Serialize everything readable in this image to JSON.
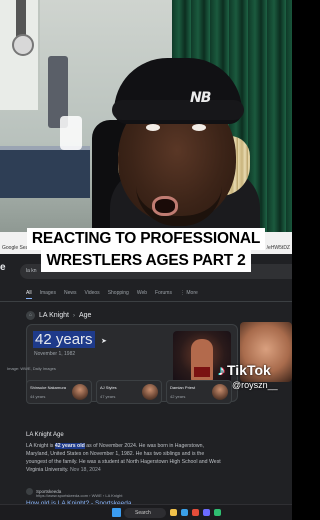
{
  "caption": {
    "line1": "REACTING TO PROFESSIONAL",
    "line2": "WRESTLERS AGES PART 2"
  },
  "cam": {
    "beanie_logo": "NB"
  },
  "desktop_strip": {
    "left_text": "Google Sea",
    "right_text": "/eHW5tDZ"
  },
  "browser": {
    "search_value": "la kn",
    "tabs": [
      "All",
      "Images",
      "News",
      "Videos",
      "Shopping",
      "Web",
      "Forums",
      "⋮ More"
    ],
    "knowledge": {
      "breadcrumb": "LA Knight",
      "subject": "Age",
      "answer": "42 years",
      "birth_date": "November 1, 1982",
      "image_credit": "Image: WWE, Daily Images"
    },
    "people": [
      {
        "name": "Shinsuke Nakamura",
        "age": "44 years"
      },
      {
        "name": "AJ Styles",
        "age": "47 years"
      },
      {
        "name": "Damian Priest",
        "age": "42 years"
      }
    ],
    "section_title": "LA Knight Age",
    "snippet": {
      "pre": "LA Knight is ",
      "highlight": "42 years old",
      "post": " as of November 2024. He was born in Hagerstown, Maryland, United States on November 1, 1982. He has two siblings and is the youngest of the family. He was a student at North Hagerstown High School and West Virginia University.",
      "date": "Nov 18, 2024"
    },
    "source": {
      "name": "Sportskeeda",
      "url": "https://www.sportskeeda.com › WWE › LA Knight"
    },
    "result_link": "How old is LA Knight? - Sportskeeda"
  },
  "taskbar": {
    "search_label": "Search"
  },
  "tiktok": {
    "logo": "TikTok",
    "handle": "@royszn__"
  }
}
